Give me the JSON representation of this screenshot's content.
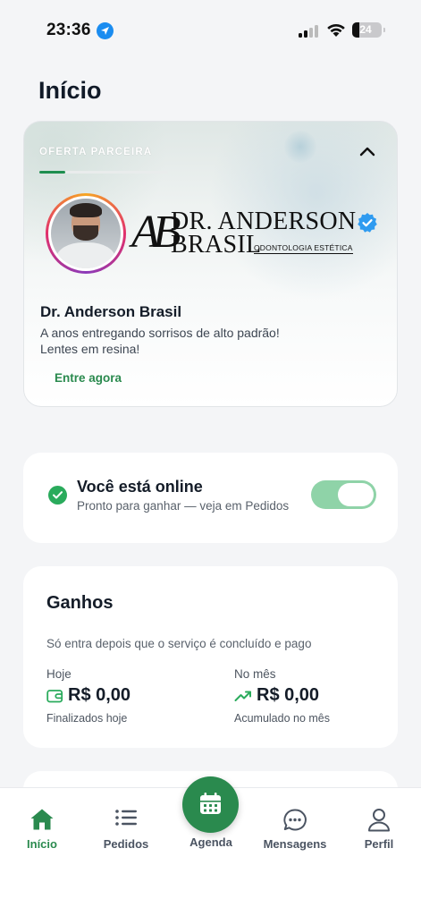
{
  "status_bar": {
    "time": "23:36",
    "battery": "24",
    "battery_level": 0.24
  },
  "page": {
    "title": "Início"
  },
  "promo": {
    "tag": "OFERTA PARCEIRA",
    "progress": 0.2,
    "logo_monogram": "AB",
    "logo_line1": "DR. ANDERSON",
    "logo_line2": "BRASIL",
    "logo_sub": "ODONTOLOGIA ESTÉTICA",
    "name": "Dr. Anderson Brasil",
    "description": "A anos entregando sorrisos de alto padrão! Lentes em resina!",
    "cta": "Entre agora",
    "icons": [
      "chevron-up-icon",
      "verified-badge-icon"
    ]
  },
  "online": {
    "title": "Você está online",
    "subtitle": "Pronto para ganhar — veja em Pedidos",
    "toggle_on": true,
    "accent": "#2aab5c"
  },
  "earnings": {
    "title": "Ganhos",
    "note": "Só entra depois que o serviço é concluído e pago",
    "today": {
      "label": "Hoje",
      "value": "R$ 0,00",
      "caption": "Finalizados hoje",
      "icon": "wallet-icon"
    },
    "month": {
      "label": "No mês",
      "value": "R$ 0,00",
      "caption": "Acumulado no mês",
      "icon": "trending-up-icon"
    }
  },
  "nav": {
    "items": [
      {
        "label": "Início",
        "icon": "home-icon",
        "active": true
      },
      {
        "label": "Pedidos",
        "icon": "list-icon",
        "active": false
      },
      {
        "label": "Agenda",
        "icon": "calendar-icon",
        "active": false
      },
      {
        "label": "Mensagens",
        "icon": "chat-icon",
        "active": false
      },
      {
        "label": "Perfil",
        "icon": "user-icon",
        "active": false
      }
    ],
    "accent": "#2a8a4e"
  }
}
